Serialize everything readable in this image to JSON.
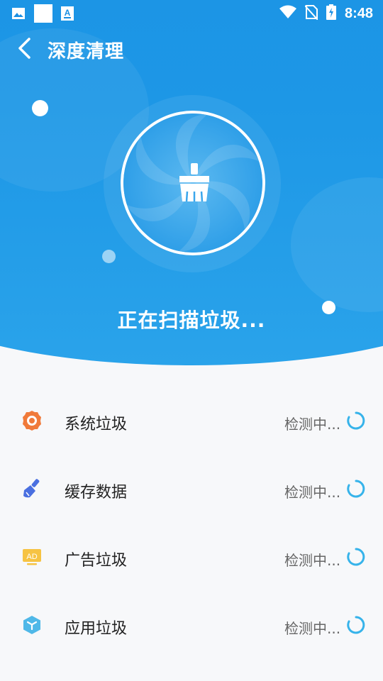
{
  "status_bar": {
    "time": "8:48",
    "left_icons": [
      "gallery-icon",
      "white-square-icon",
      "font-a-icon"
    ],
    "right_icons": [
      "wifi-icon",
      "no-sim-icon",
      "battery-charging-icon"
    ]
  },
  "toolbar": {
    "title": "深度清理",
    "back_icon": "chevron-left-icon"
  },
  "scan": {
    "status_text": "正在扫描垃圾...",
    "center_icon": "broom-icon"
  },
  "colors": {
    "primary_blue": "#1d97e6",
    "spinner": "#36b3ea",
    "system_icon": "#f07a3a",
    "cache_icon": "#4a6fe0",
    "ad_icon": "#f6c343",
    "app_icon": "#4fb8e8"
  },
  "items": [
    {
      "label": "系统垃圾",
      "status": "检测中...",
      "icon": "gear-icon"
    },
    {
      "label": "缓存数据",
      "status": "检测中...",
      "icon": "brush-icon"
    },
    {
      "label": "广告垃圾",
      "status": "检测中...",
      "icon": "ad-icon"
    },
    {
      "label": "应用垃圾",
      "status": "检测中...",
      "icon": "cube-icon"
    }
  ]
}
